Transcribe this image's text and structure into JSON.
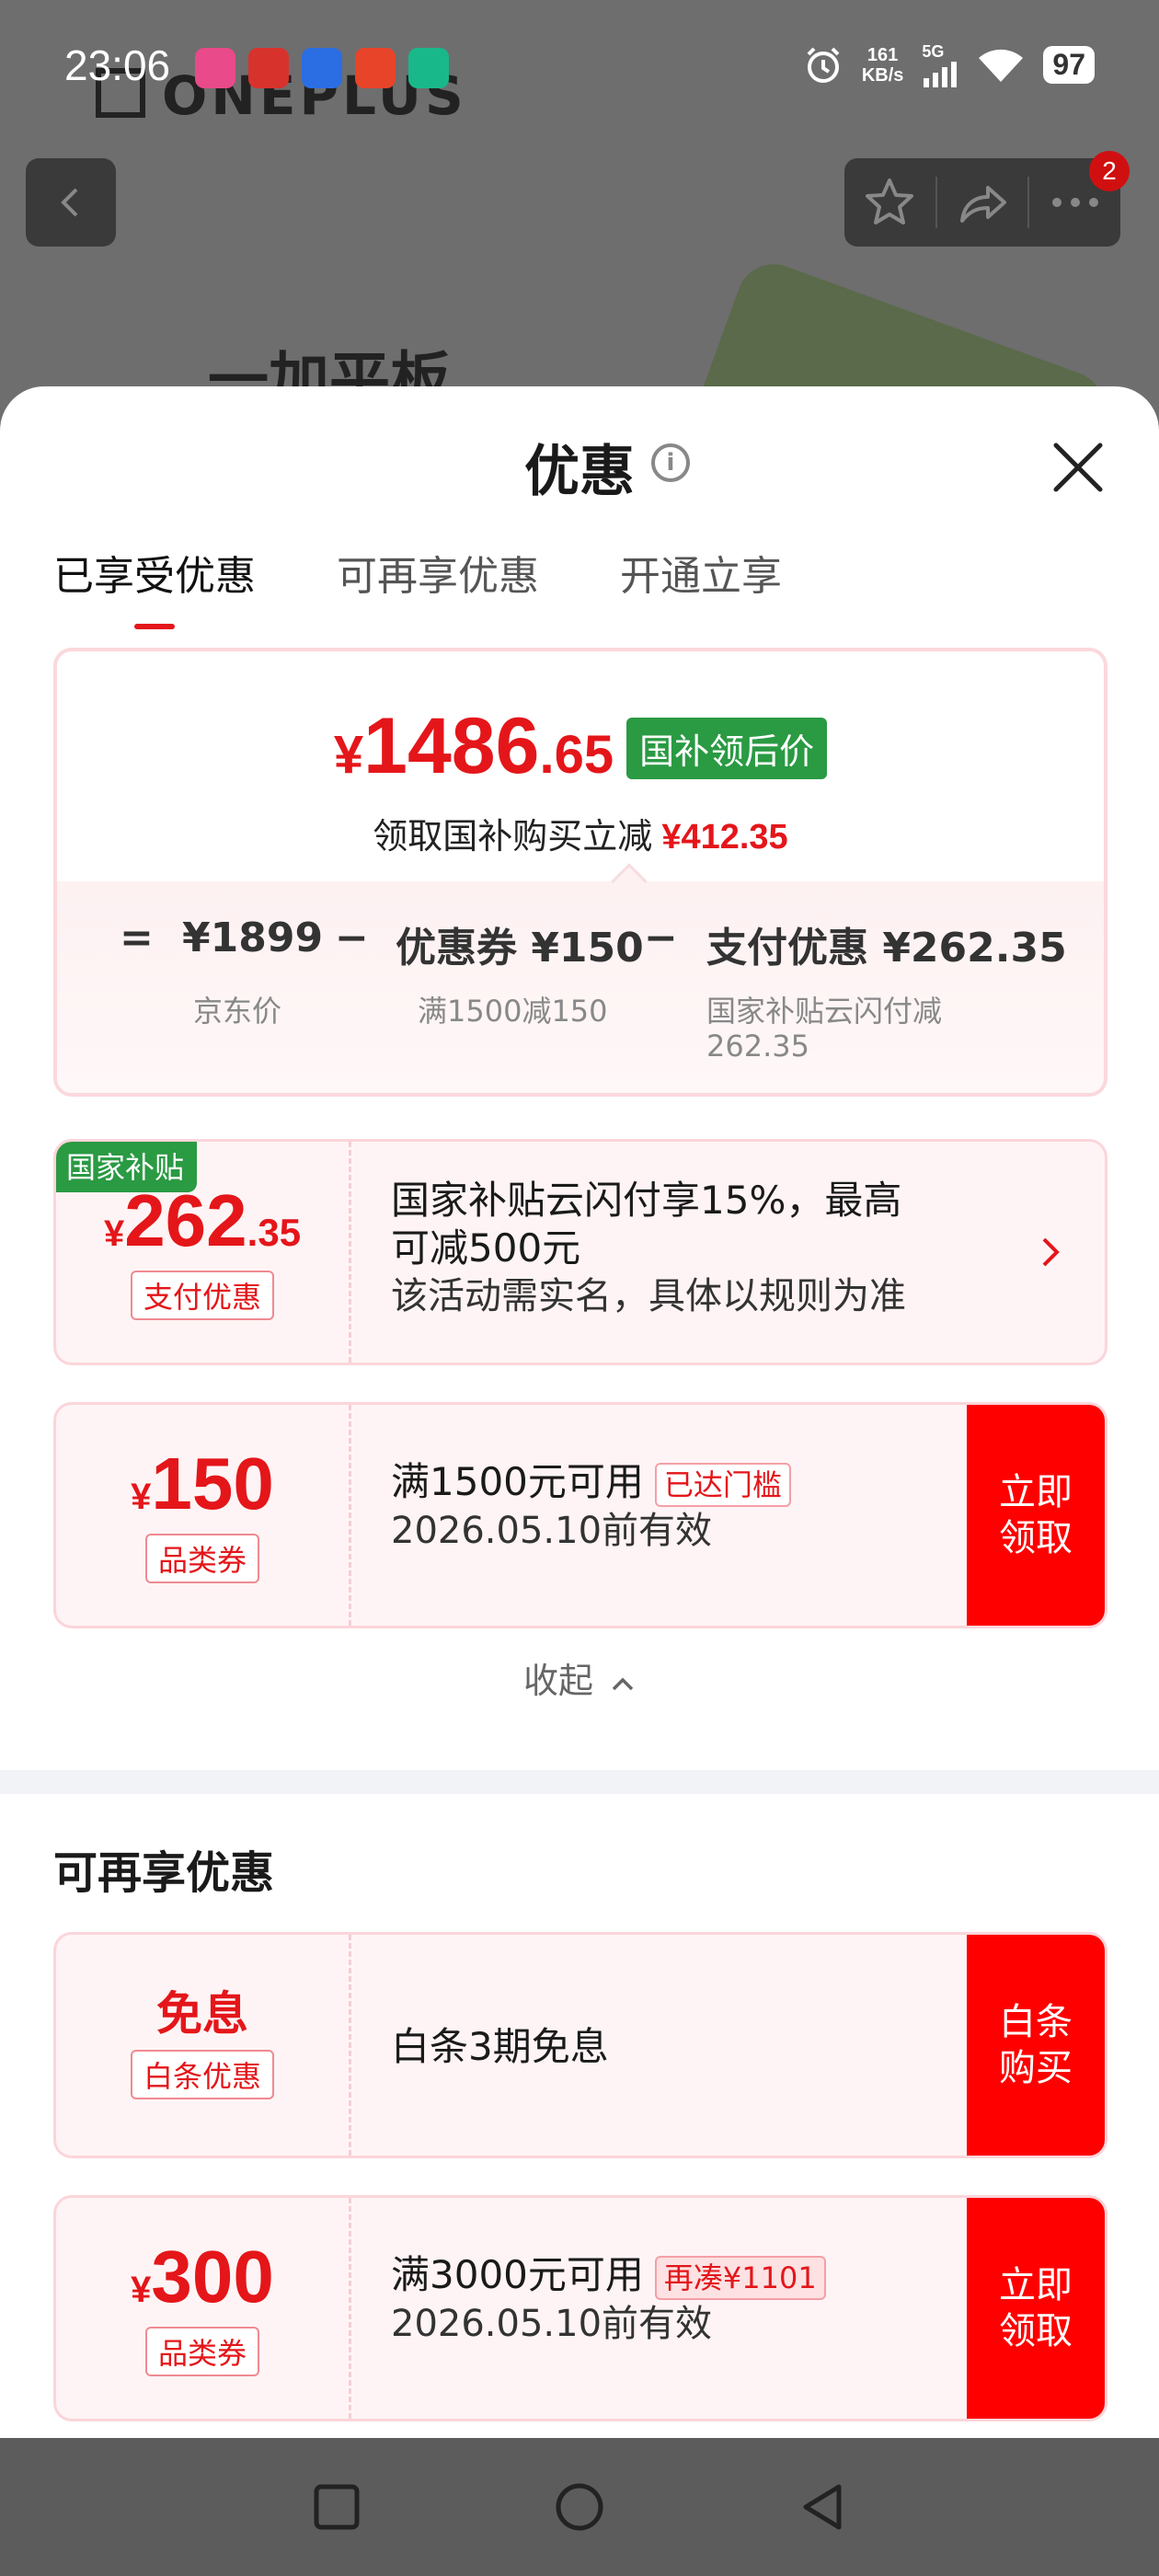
{
  "status_bar": {
    "time": "23:06",
    "net_speed_value": "161",
    "net_speed_unit": "KB/s",
    "network": "5G",
    "battery": "97"
  },
  "background": {
    "brand": "ONEPLUS",
    "page_title": "一加平板",
    "notification_count": "2"
  },
  "sheet": {
    "title": "优惠",
    "tabs": [
      "已享受优惠",
      "可再享优惠",
      "开通立享"
    ],
    "price_card": {
      "currency": "¥",
      "price_int": "1486",
      "price_dec": ".65",
      "tag": "国补领后价",
      "save_text": "领取国补购买立减",
      "save_amount": "¥412.35",
      "equals": "=",
      "minus": "−",
      "jd_price": "¥1899",
      "jd_price_label": "京东价",
      "coupon_label": "优惠券 ¥150",
      "coupon_desc": "满1500减150",
      "pay_label": "支付优惠 ¥262.35",
      "pay_desc_1": "国家补贴云闪付减",
      "pay_desc_2": "262.35"
    },
    "subsidy_card": {
      "badge": "国家补贴",
      "currency": "¥",
      "amount_int": "262",
      "amount_dec": ".35",
      "label": "支付优惠",
      "line1": "国家补贴云闪付享15%，最高",
      "line2": "可减500元",
      "line3": "该活动需实名，具体以规则为准"
    },
    "coupon_150": {
      "currency": "¥",
      "amount": "150",
      "label": "品类券",
      "condition": "满1500元可用",
      "tag": "已达门槛",
      "validity": "2026.05.10前有效",
      "button": "立即领取"
    },
    "collapse": "收起",
    "more_section_title": "可再享优惠",
    "installment_card": {
      "amount": "免息",
      "label": "白条优惠",
      "text": "白条3期免息",
      "button": "白条购买"
    },
    "coupon_300": {
      "currency": "¥",
      "amount": "300",
      "label": "品类券",
      "condition": "满3000元可用",
      "tag": "再凑¥1101",
      "validity": "2026.05.10前有效",
      "button": "立即领取"
    }
  }
}
